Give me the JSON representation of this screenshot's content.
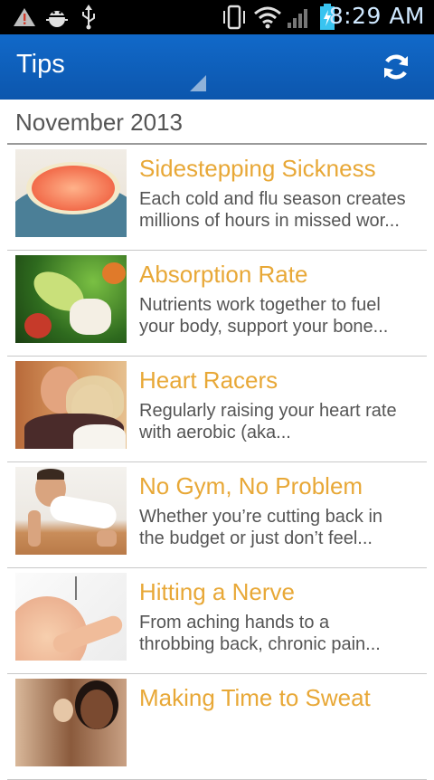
{
  "status_bar": {
    "time": "8:29 AM",
    "icons": [
      "warning-icon",
      "android-debug-icon",
      "usb-icon",
      "vibrate-icon",
      "wifi-icon",
      "signal-icon",
      "battery-charging-icon"
    ]
  },
  "action_bar": {
    "title": "Tips",
    "refresh_icon": "refresh-icon",
    "accent_color": "#0f62bf"
  },
  "section": {
    "header": "November 2013"
  },
  "tips": [
    {
      "title": "Sidestepping Sickness",
      "desc_line1": "Each cold and flu season creates",
      "desc_line2": "millions of hours in missed wor...",
      "image": "grapefruit-image"
    },
    {
      "title": "Absorption Rate",
      "desc_line1": "Nutrients work together to fuel",
      "desc_line2": "your body, support your bone...",
      "image": "salad-image"
    },
    {
      "title": "Heart Racers",
      "desc_line1": "Regularly raising your heart rate",
      "desc_line2": "with aerobic (aka...",
      "image": "couple-image"
    },
    {
      "title": "No Gym, No Problem",
      "desc_line1": "Whether you’re cutting back in",
      "desc_line2": "the budget or just don’t feel...",
      "image": "pushup-image"
    },
    {
      "title": "Hitting a Nerve",
      "desc_line1": "From aching hands to a",
      "desc_line2": "throbbing back, chronic pain...",
      "image": "hand-image"
    },
    {
      "title": "Making Time to Sweat",
      "desc_line1": "",
      "desc_line2": "",
      "image": "woman-image"
    }
  ],
  "colors": {
    "title": "#e8a837",
    "text": "#555555",
    "divider": "#c8c8c8"
  }
}
